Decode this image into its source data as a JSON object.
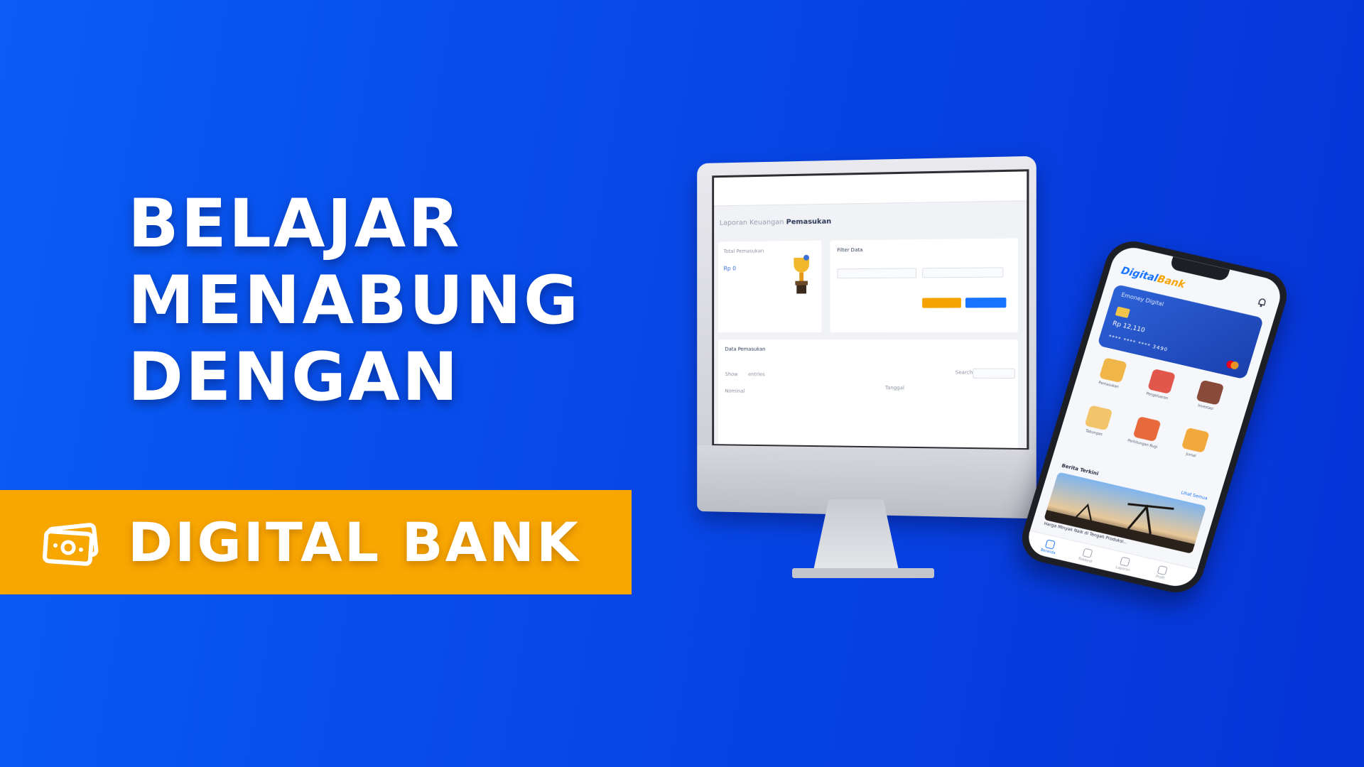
{
  "headline": {
    "line1": "BELAJAR",
    "line2": "MENABUNG",
    "line3": "DENGAN"
  },
  "banner": {
    "label": "DIGITAL BANK",
    "icon": "money-icon",
    "background_color": "#f8a600"
  },
  "monitor_app": {
    "breadcrumb_prefix": "Laporan Keuangan",
    "breadcrumb_current": "Pemasukan",
    "summary_title": "Total Pemasukan",
    "summary_amount": "Rp 0",
    "filter_title": "Filter Data",
    "table_title": "Data Pemasukan",
    "show_label": "Show",
    "entries_label": "entries",
    "search_label": "Search:",
    "col_nominal": "Nominal",
    "col_tanggal": "Tanggal"
  },
  "phone_app": {
    "logo_main": "Digital",
    "logo_accent": "Bank",
    "card_name": "Emoney Digital",
    "card_balance": "Rp 12,110",
    "card_number": "**** **** **** 3490",
    "menu": [
      {
        "label": "Pemasukan"
      },
      {
        "label": "Pengeluaran"
      },
      {
        "label": "Investasi"
      },
      {
        "label": "Tabungan"
      },
      {
        "label": "Perhitungan Rugi"
      },
      {
        "label": "Jurnal"
      }
    ],
    "promo_title": "Berita Terkini",
    "promo_more": "Lihat Semua",
    "promo_caption": "Harga Minyak Naik di Tengah Produksi...",
    "tabs": [
      {
        "label": "Beranda"
      },
      {
        "label": "Riwayat"
      },
      {
        "label": "Laporan"
      },
      {
        "label": "Profil"
      }
    ]
  },
  "colors": {
    "background": "#0748e8",
    "accent": "#f8a600",
    "app_blue": "#1672ff"
  }
}
